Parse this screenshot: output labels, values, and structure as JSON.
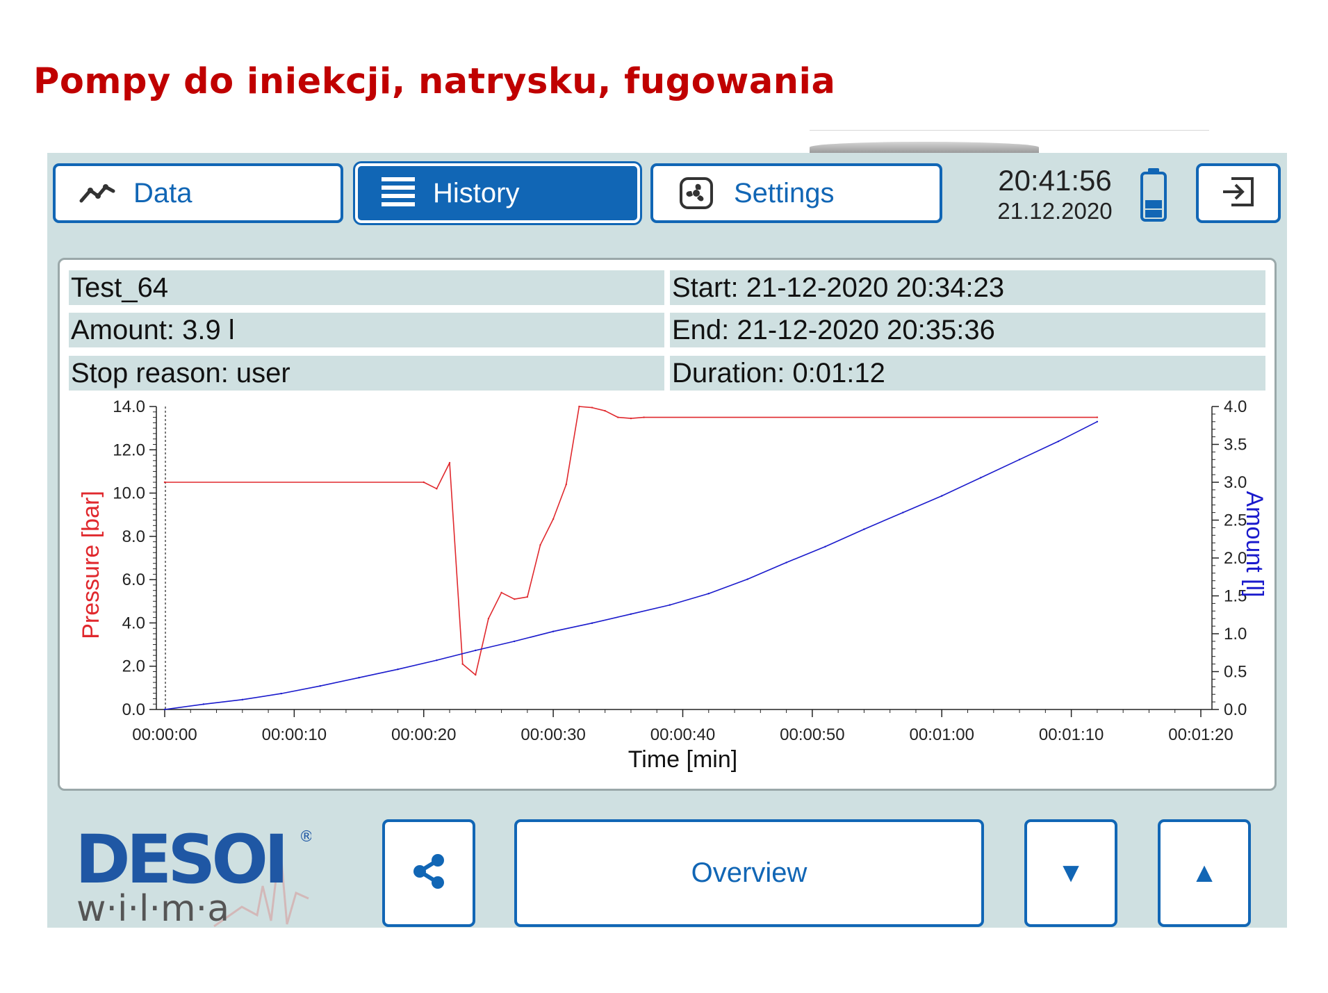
{
  "slide_title": "Pompy do iniekcji, natrysku, fugowania",
  "colors": {
    "accent": "#1166b5",
    "screen_bg": "#cfe0e1",
    "title_red": "#c00000",
    "pressure_red": "#e0282d",
    "amount_blue": "#1a1acc"
  },
  "tabs": [
    {
      "label": "Data",
      "icon": "trend-line-icon",
      "active": false
    },
    {
      "label": "History",
      "icon": "list-icon",
      "active": true
    },
    {
      "label": "Settings",
      "icon": "fan-gear-icon",
      "active": false
    }
  ],
  "status": {
    "time": "20:41:56",
    "date": "21.12.2020",
    "battery_icon": "battery-icon",
    "exit_icon": "logout-icon"
  },
  "record": {
    "name": "Test_64",
    "start": "Start: 21-12-2020 20:34:23",
    "amount": "Amount: 3.9 l",
    "end": "End: 21-12-2020 20:35:36",
    "stop_reason": "Stop reason: user",
    "duration": "Duration: 0:01:12"
  },
  "chart_data": {
    "type": "line",
    "title": "",
    "xlabel": "Time [min]",
    "ylabel": "Pressure [bar]",
    "y2label": "Amount [l]",
    "xlim": [
      0,
      80
    ],
    "ylim": [
      0,
      14
    ],
    "y2lim": [
      0,
      4
    ],
    "x_ticks": [
      "00:00:00",
      "00:00:10",
      "00:00:20",
      "00:00:30",
      "00:00:40",
      "00:00:50",
      "00:01:00",
      "00:01:10",
      "00:01:20"
    ],
    "y_ticks": [
      "0.0",
      "2.0",
      "4.0",
      "6.0",
      "8.0",
      "10.0",
      "12.0",
      "14.0"
    ],
    "y2_ticks": [
      "0.0",
      "0.5",
      "1.0",
      "1.5",
      "2.0",
      "2.5",
      "3.0",
      "3.5",
      "4.0"
    ],
    "series": [
      {
        "name": "Pressure [bar]",
        "axis": "left",
        "x": [
          0,
          20,
          21,
          22,
          23,
          24,
          25,
          26,
          27,
          28,
          29,
          30,
          31,
          32,
          33,
          34,
          35,
          36,
          37,
          72
        ],
        "y": [
          10.5,
          10.5,
          10.2,
          11.4,
          2.1,
          1.6,
          4.2,
          5.4,
          5.1,
          5.2,
          7.6,
          8.8,
          10.4,
          14.0,
          13.95,
          13.8,
          13.5,
          13.45,
          13.5,
          13.5
        ]
      },
      {
        "name": "Amount [l]",
        "axis": "right",
        "x": [
          0,
          3,
          6,
          9,
          12,
          15,
          18,
          21,
          24,
          27,
          30,
          33,
          36,
          39,
          42,
          45,
          48,
          51,
          54,
          57,
          60,
          63,
          66,
          69,
          72
        ],
        "y": [
          0.0,
          0.07,
          0.13,
          0.21,
          0.31,
          0.42,
          0.53,
          0.65,
          0.78,
          0.9,
          1.03,
          1.14,
          1.26,
          1.38,
          1.53,
          1.72,
          1.94,
          2.15,
          2.38,
          2.6,
          2.82,
          3.06,
          3.3,
          3.54,
          3.8
        ]
      }
    ]
  },
  "bottom": {
    "logo_main": "DESOI",
    "logo_registered": "®",
    "logo_sub": "w·i·l·m·a",
    "share_icon": "share-icon",
    "overview_label": "Overview",
    "down_label": "▼",
    "up_label": "▲"
  }
}
